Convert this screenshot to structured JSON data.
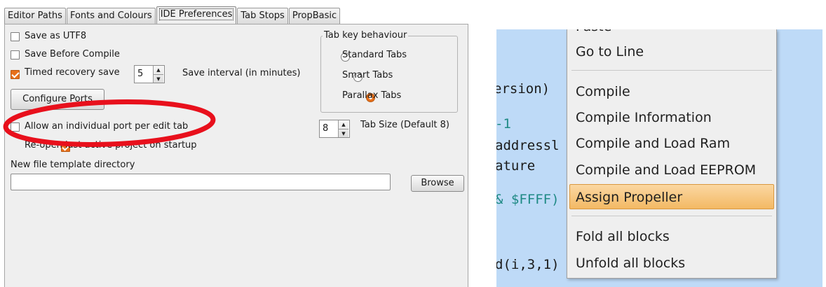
{
  "tabs": [
    {
      "label": "Editor Paths",
      "active": false
    },
    {
      "label": "Fonts and Colours",
      "active": false
    },
    {
      "label": "IDE Preferences",
      "active": true
    },
    {
      "label": "Tab Stops",
      "active": false
    },
    {
      "label": "PropBasic",
      "active": false
    }
  ],
  "options": {
    "save_utf8": {
      "label": "Save as UTF8",
      "checked": false
    },
    "save_before_compile": {
      "label": "Save Before Compile",
      "checked": false
    },
    "timed_recovery": {
      "label": "Timed recovery save",
      "checked": true
    },
    "allow_port_per_tab": {
      "label": "Allow an individual port per edit tab",
      "checked": false
    },
    "reopen_last_project": {
      "label": "Re-open last active project on startup",
      "checked": true
    }
  },
  "save_interval": {
    "value": "5",
    "label": "Save interval (in minutes)"
  },
  "configure_ports_label": "Configure Ports",
  "tab_key_behaviour": {
    "title": "Tab key behaviour",
    "options": [
      {
        "label": "Standard Tabs",
        "selected": false
      },
      {
        "label": "Smart Tabs",
        "selected": false
      },
      {
        "label": "Parallax Tabs",
        "selected": true
      }
    ]
  },
  "tab_size": {
    "value": "8",
    "label": "Tab Size (Default 8)"
  },
  "template_dir": {
    "label": "New file template directory",
    "value": "",
    "browse_label": "Browse"
  },
  "annotation": {
    "color": "#e8101c"
  },
  "accent_color": "#e8701a",
  "editor": {
    "background": "#bedaf7",
    "code_fragments": [
      "ersion)",
      "-1",
      "addressl",
      "ature",
      "& $FFFF)",
      "d(i,3,1)"
    ],
    "context_menu": {
      "top_partial": "Paste",
      "items": [
        {
          "label": "Go to Line",
          "highlighted": false
        },
        {
          "label": "Compile",
          "highlighted": false
        },
        {
          "label": "Compile Information",
          "highlighted": false
        },
        {
          "label": "Compile and Load Ram",
          "highlighted": false
        },
        {
          "label": "Compile and Load EEPROM",
          "highlighted": false
        },
        {
          "label": "Assign Propeller",
          "highlighted": true
        },
        {
          "label": "Fold all blocks",
          "highlighted": false
        },
        {
          "label": "Unfold all blocks",
          "highlighted": false
        }
      ]
    }
  }
}
